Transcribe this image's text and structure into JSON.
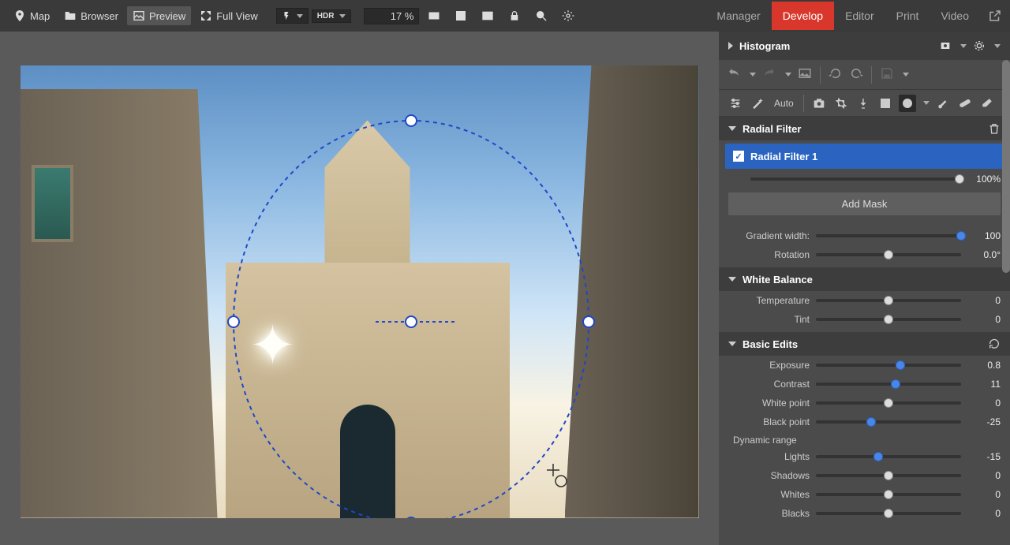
{
  "topbar": {
    "map": "Map",
    "browser": "Browser",
    "preview": "Preview",
    "fullview": "Full View",
    "hdr": "HDR",
    "zoom": "17 %"
  },
  "modes": {
    "manager": "Manager",
    "develop": "Develop",
    "editor": "Editor",
    "print": "Print",
    "video": "Video"
  },
  "panel": {
    "histogram": "Histogram",
    "auto": "Auto",
    "radial_filter_head": "Radial Filter",
    "radial_filter_item": "Radial Filter 1",
    "mask_pct": "100%",
    "add_mask": "Add Mask",
    "gradient_width_label": "Gradient width:",
    "gradient_width_val": "100",
    "rotation_label": "Rotation",
    "rotation_val": "0.0°",
    "white_balance": "White Balance",
    "temperature_label": "Temperature",
    "temperature_val": "0",
    "tint_label": "Tint",
    "tint_val": "0",
    "basic_edits": "Basic Edits",
    "exposure_label": "Exposure",
    "exposure_val": "0.8",
    "contrast_label": "Contrast",
    "contrast_val": "11",
    "whitepoint_label": "White point",
    "whitepoint_val": "0",
    "blackpoint_label": "Black point",
    "blackpoint_val": "-25",
    "dynamic_range": "Dynamic range",
    "lights_label": "Lights",
    "lights_val": "-15",
    "shadows_label": "Shadows",
    "shadows_val": "0",
    "whites_label": "Whites",
    "whites_val": "0",
    "blacks_label": "Blacks",
    "blacks_val": "0"
  }
}
